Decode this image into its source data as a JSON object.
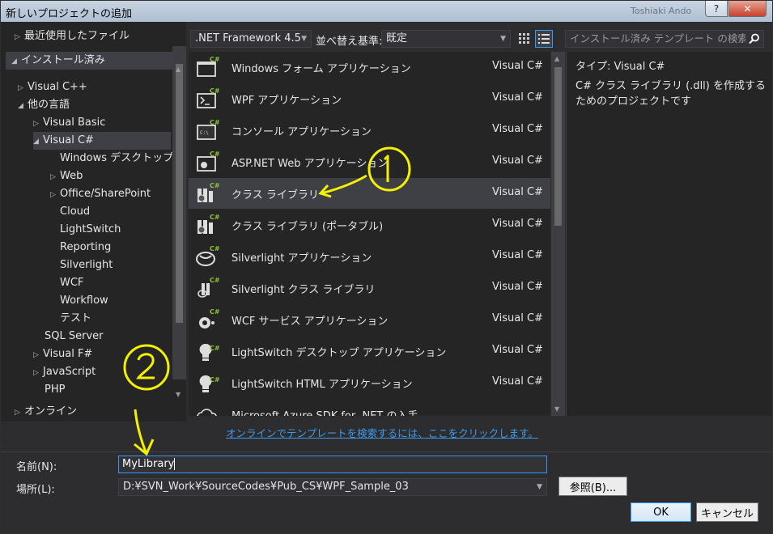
{
  "window": {
    "title": "新しいプロジェクトの追加",
    "ghost_title": "Toshiaki Ando",
    "help_label": "?",
    "close_label": "✕"
  },
  "tree": {
    "recent": "最近使用したファイル",
    "installed": "インストール済み",
    "items": [
      {
        "label": "Visual C++"
      },
      {
        "label": "他の言語"
      },
      {
        "label": "Visual Basic"
      },
      {
        "label": "Visual C#"
      },
      {
        "label": "Windows デスクトップ"
      },
      {
        "label": "Web"
      },
      {
        "label": "Office/SharePoint"
      },
      {
        "label": "Cloud"
      },
      {
        "label": "LightSwitch"
      },
      {
        "label": "Reporting"
      },
      {
        "label": "Silverlight"
      },
      {
        "label": "WCF"
      },
      {
        "label": "Workflow"
      },
      {
        "label": "テスト"
      },
      {
        "label": "SQL Server"
      },
      {
        "label": "Visual F#"
      },
      {
        "label": "JavaScript"
      },
      {
        "label": "PHP"
      }
    ],
    "online": "オンライン"
  },
  "toolbar": {
    "framework": ".NET Framework 4.5",
    "sort_label": "並べ替え基準:",
    "sort_value": "既定",
    "search_placeholder": "インストール済み テンプレート の検索 (Ct"
  },
  "templates": [
    {
      "name": "Windows フォーム アプリケーション",
      "lang": "Visual C#",
      "icon": "winforms-icon"
    },
    {
      "name": "WPF アプリケーション",
      "lang": "Visual C#",
      "icon": "wpf-icon"
    },
    {
      "name": "コンソール アプリケーション",
      "lang": "Visual C#",
      "icon": "console-icon"
    },
    {
      "name": "ASP.NET Web アプリケーション",
      "lang": "Visual C#",
      "icon": "web-icon"
    },
    {
      "name": "クラス ライブラリ",
      "lang": "Visual C#",
      "icon": "class-library-icon"
    },
    {
      "name": "クラス ライブラリ (ポータブル)",
      "lang": "Visual C#",
      "icon": "portable-library-icon"
    },
    {
      "name": "Silverlight アプリケーション",
      "lang": "Visual C#",
      "icon": "silverlight-icon"
    },
    {
      "name": "Silverlight クラス ライブラリ",
      "lang": "Visual C#",
      "icon": "silverlight-library-icon"
    },
    {
      "name": "WCF サービス アプリケーション",
      "lang": "Visual C#",
      "icon": "wcf-icon"
    },
    {
      "name": "LightSwitch デスクトップ アプリケーション",
      "lang": "Visual C#",
      "icon": "lightswitch-icon"
    },
    {
      "name": "LightSwitch HTML アプリケーション",
      "lang": "Visual C#",
      "icon": "lightswitch-html-icon"
    },
    {
      "name": "Microsoft Azure SDK for .NET の入手",
      "lang": "",
      "icon": "azure-icon"
    }
  ],
  "description": {
    "type_line": "タイプ:  Visual C#",
    "text": "C# クラス ライブラリ (.dll) を作成するためのプロジェクトです"
  },
  "online_link": "オンラインでテンプレートを検索するには、ここをクリックします。",
  "form": {
    "name_label": "名前(N):",
    "name_value": "MyLibrary",
    "location_label": "場所(L):",
    "location_value": "D:¥SVN_Work¥SourceCodes¥Pub_CS¥WPF_Sample_03",
    "browse_label": "参照(B)...",
    "ok_label": "OK",
    "cancel_label": "キャンセル"
  },
  "annotations": {
    "circle1": "1",
    "circle2": "2"
  },
  "colors": {
    "accent": "#3399ff",
    "link": "#3d9be9",
    "annotation": "#f5f000",
    "csharp_badge": "#8cc63f"
  }
}
